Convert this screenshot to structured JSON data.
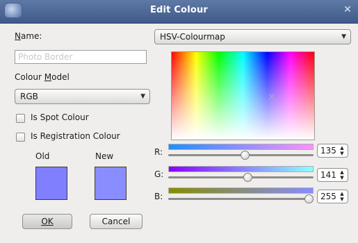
{
  "window": {
    "title": "Edit Colour",
    "close_glyph": "✕"
  },
  "form": {
    "name_label": "Name:",
    "name_value": "Photo Border",
    "colour_model_label": "Colour Model",
    "colour_model_value": "RGB",
    "spot_colour_label": "Is Spot Colour",
    "registration_colour_label": "Is Registration Colour",
    "spot_colour_checked": false,
    "registration_colour_checked": false
  },
  "swatches": {
    "old_label": "Old",
    "new_label": "New",
    "old_color": "#8080ff",
    "new_color": "#8a8dff"
  },
  "buttons": {
    "ok_label": "OK",
    "cancel_label": "Cancel"
  },
  "colourmap": {
    "mode": "HSV-Colourmap"
  },
  "sliders": [
    {
      "label": "R:",
      "value": "135",
      "fraction": 0.53,
      "gradient": [
        "#1f8fff",
        "#ff8fff"
      ]
    },
    {
      "label": "G:",
      "value": "141",
      "fraction": 0.55,
      "gradient": [
        "#8a00ff",
        "#8affff"
      ]
    },
    {
      "label": "B:",
      "value": "255",
      "fraction": 1.0,
      "gradient": [
        "#878d00",
        "#878dff"
      ]
    }
  ],
  "icons": {
    "arrow_down": "▼",
    "spin_up": "▲",
    "spin_down": "▼",
    "crosshair": "✕"
  }
}
